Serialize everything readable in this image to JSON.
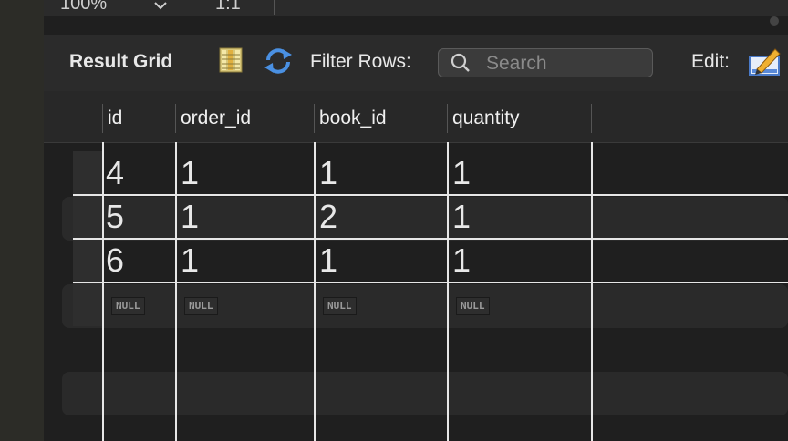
{
  "zoom": {
    "value": "100%",
    "ratio": "1:1"
  },
  "toolbar": {
    "result_grid_label": "Result Grid",
    "filter_label": "Filter Rows:",
    "search_placeholder": "Search",
    "edit_label": "Edit:"
  },
  "grid": {
    "columns": [
      "id",
      "order_id",
      "book_id",
      "quantity"
    ],
    "rows": [
      [
        "4",
        "1",
        "1",
        "1"
      ],
      [
        "5",
        "1",
        "2",
        "1"
      ],
      [
        "6",
        "1",
        "1",
        "1"
      ]
    ],
    "new_row": [
      "NULL",
      "NULL",
      "NULL",
      "NULL"
    ]
  },
  "icons": {
    "columns": "columns-icon",
    "refresh": "refresh-icon",
    "search": "search-icon",
    "edit": "edit-icon",
    "chevron": "chevron-down-icon"
  },
  "colors": {
    "accent_blue": "#4a90e2",
    "background": "#1f1f1f"
  }
}
